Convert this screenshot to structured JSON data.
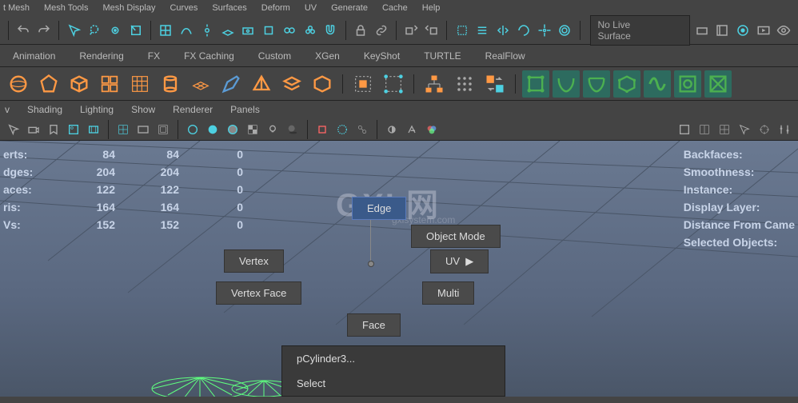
{
  "topmenu": [
    "t Mesh",
    "Mesh Tools",
    "Mesh Display",
    "Curves",
    "Surfaces",
    "Deform",
    "UV",
    "Generate",
    "Cache",
    "Help"
  ],
  "toolbar": {
    "live_surface": "No Live Surface"
  },
  "tabs": [
    "Animation",
    "Rendering",
    "FX",
    "FX Caching",
    "Custom",
    "XGen",
    "KeyShot",
    "TURTLE",
    "RealFlow"
  ],
  "viewmenu": [
    "v",
    "Shading",
    "Lighting",
    "Show",
    "Renderer",
    "Panels"
  ],
  "hud_left": {
    "rows": [
      {
        "label": "erts:",
        "c1": "84",
        "c2": "84",
        "c3": "0"
      },
      {
        "label": "dges:",
        "c1": "204",
        "c2": "204",
        "c3": "0"
      },
      {
        "label": "aces:",
        "c1": "122",
        "c2": "122",
        "c3": "0"
      },
      {
        "label": "ris:",
        "c1": "164",
        "c2": "164",
        "c3": "0"
      },
      {
        "label": "Vs:",
        "c1": "152",
        "c2": "152",
        "c3": "0"
      }
    ]
  },
  "hud_right": [
    "Backfaces:",
    "Smoothness:",
    "Instance:",
    "Display Layer:",
    "Distance From Came",
    "Selected Objects:"
  ],
  "radial": {
    "edge": "Edge",
    "object": "Object Mode",
    "vertex": "Vertex",
    "uv": "UV",
    "vertex_face": "Vertex Face",
    "multi": "Multi",
    "face": "Face"
  },
  "ctx": {
    "obj": "pCylinder3...",
    "select": "Select"
  },
  "watermark": {
    "main": "GXI 网",
    "sub": "gxlsystem.com"
  },
  "colors": {
    "cyan": "#4dd0e1",
    "orange": "#ff9944",
    "teal": "#2d6b5f",
    "green": "#4cb050"
  }
}
